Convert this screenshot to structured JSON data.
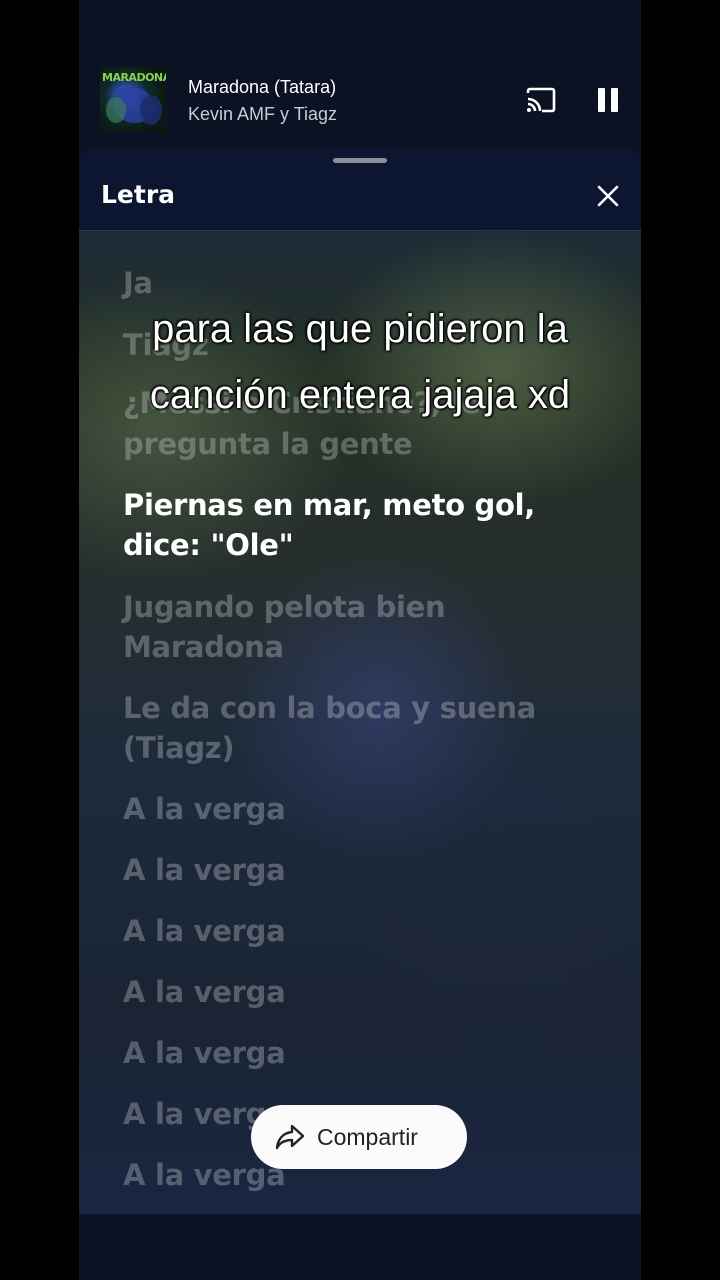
{
  "player": {
    "album_art_text": "MARADONA",
    "title": "Maradona (Tatara)",
    "artist": "Kevin AMF y Tiagz",
    "cast_icon": "cast-icon",
    "pause_icon": "pause-icon"
  },
  "sheet": {
    "title": "Letra",
    "close_icon": "close-icon"
  },
  "lyrics": {
    "lines": [
      "Ja",
      "Tiagz",
      "¿Messi o Cristiano?, le",
      "pregunta la gente",
      "Piernas en mar, meto gol,",
      "dice: \"Ole\"",
      "Jugando pelota bien",
      "Maradona",
      "Le da con la boca y suena",
      "(Tiagz)",
      "A la verga",
      "A la verga",
      "A la verga",
      "A la verga",
      "A la verga",
      "A la verga",
      "A la verga"
    ]
  },
  "overlay": {
    "line1": "para las que pidieron la",
    "line2": "canción entera jajaja xd"
  },
  "share": {
    "label": "Compartir",
    "icon": "share-icon"
  }
}
